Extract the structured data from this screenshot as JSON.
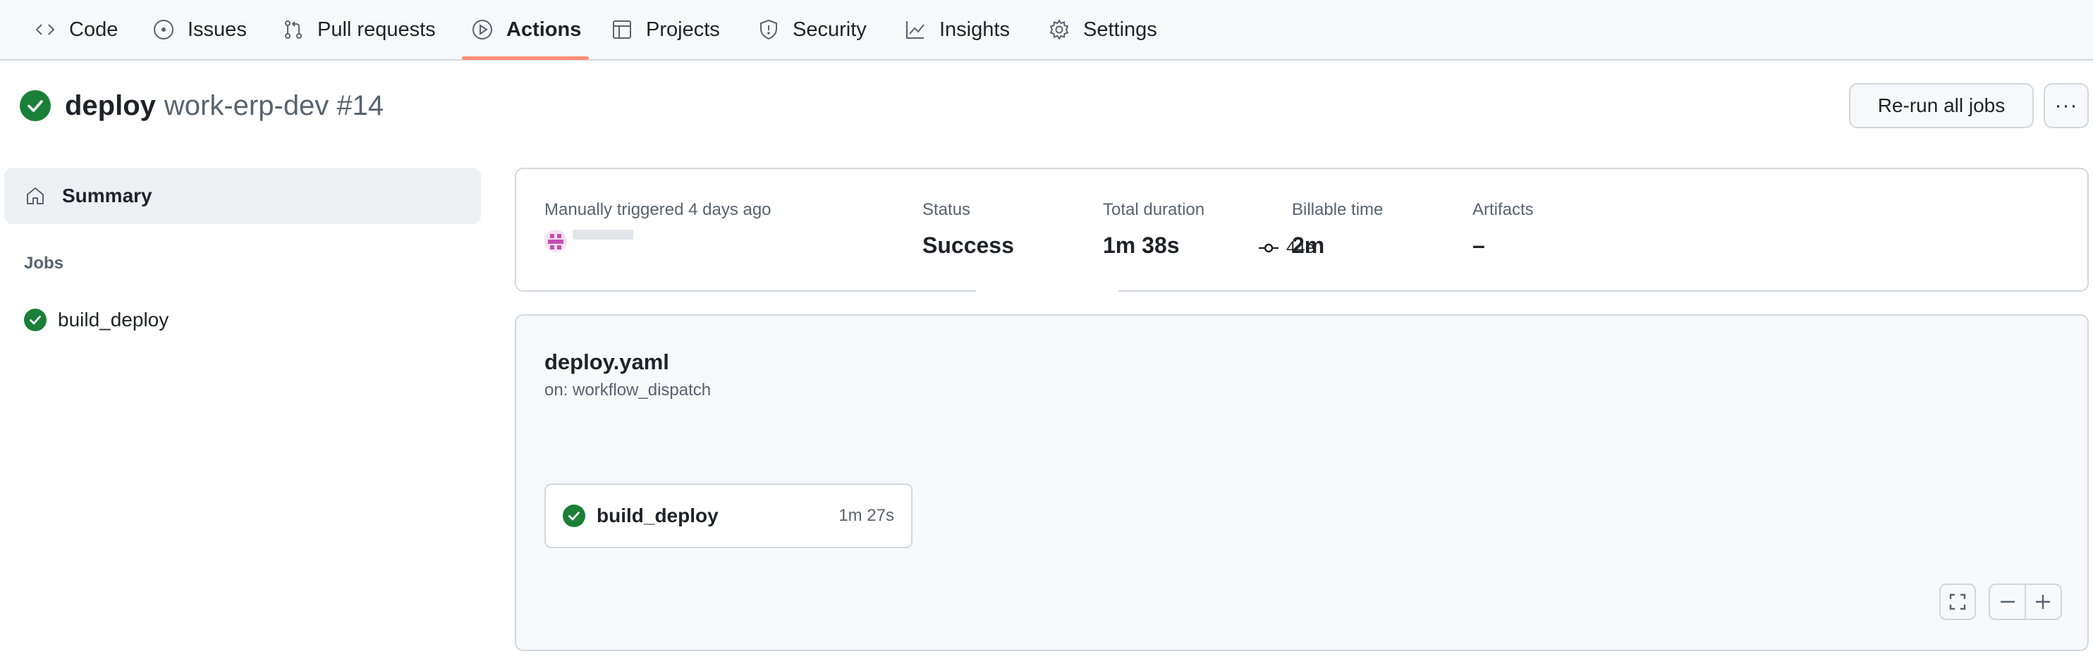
{
  "nav": {
    "items": [
      {
        "label": "Code",
        "icon": "code-icon"
      },
      {
        "label": "Issues",
        "icon": "issue-opened-icon"
      },
      {
        "label": "Pull requests",
        "icon": "git-pull-request-icon"
      },
      {
        "label": "Actions",
        "icon": "play-icon",
        "active": true
      },
      {
        "label": "Projects",
        "icon": "table-icon"
      },
      {
        "label": "Security",
        "icon": "shield-icon"
      },
      {
        "label": "Insights",
        "icon": "graph-icon"
      },
      {
        "label": "Settings",
        "icon": "gear-icon"
      }
    ],
    "active_underline_color": "#fd8c73"
  },
  "run": {
    "workflow": "deploy",
    "title_suffix": "work-erp-dev #14",
    "status_color": "#1a7f37"
  },
  "buttons": {
    "rerun": "Re-run all jobs",
    "more": "···"
  },
  "sidebar": {
    "summary_label": "Summary",
    "jobs_heading": "Jobs",
    "jobs": [
      {
        "name": "build_deploy",
        "status": "success"
      }
    ]
  },
  "info": {
    "trigger_label": "Manually triggered 4 days ago",
    "commit_sha": "44e",
    "status_label": "Status",
    "status_value": "Success",
    "duration_label": "Total duration",
    "duration_value": "1m 38s",
    "billable_label": "Billable time",
    "billable_value": "2m",
    "artifacts_label": "Artifacts",
    "artifacts_value": "–"
  },
  "graph": {
    "workflow_file": "deploy.yaml",
    "trigger": "on: workflow_dispatch",
    "jobs": [
      {
        "name": "build_deploy",
        "duration": "1m 27s",
        "status": "success"
      }
    ]
  }
}
